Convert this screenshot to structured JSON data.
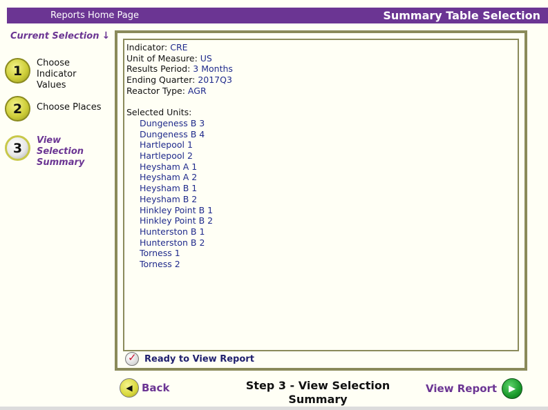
{
  "header": {
    "home_link": "Reports Home Page",
    "title": "Summary Table Selection"
  },
  "sidebar": {
    "current_selection": "Current Selection",
    "steps": [
      {
        "num": "1",
        "label_lines": [
          "Choose",
          "Indicator",
          "Values"
        ]
      },
      {
        "num": "2",
        "label_lines": [
          "Choose Places"
        ]
      },
      {
        "num": "3",
        "label_lines": [
          "View",
          "Selection",
          "Summary"
        ]
      }
    ]
  },
  "summary": {
    "indicator_label": "Indicator:",
    "indicator_value": "CRE",
    "unit_label": "Unit of Measure:",
    "unit_value": "US",
    "period_label": "Results Period:",
    "period_value": "3 Months",
    "quarter_label": "Ending Quarter:",
    "quarter_value": "2017Q3",
    "reactor_label": "Reactor Type:",
    "reactor_value": "AGR",
    "units_label": "Selected Units:",
    "units": [
      "Dungeness B 3",
      "Dungeness B 4",
      "Hartlepool 1",
      "Hartlepool 2",
      "Heysham A 1",
      "Heysham A 2",
      "Heysham B 1",
      "Heysham B 2",
      "Hinkley Point B 1",
      "Hinkley Point B 2",
      "Hunterston B 1",
      "Hunterston B 2",
      "Torness 1",
      "Torness 2"
    ]
  },
  "status": {
    "ready_text": "Ready to View Report",
    "icon": "check-icon"
  },
  "footer": {
    "back_label": "Back",
    "step_caption_line1": "Step 3 - View Selection",
    "step_caption_line2": "Summary",
    "view_report_label": "View Report"
  },
  "colors": {
    "brand_purple": "#6b3593",
    "value_blue": "#1f2a8c",
    "border_olive": "#8a8a5a",
    "next_green": "#1a9a2b"
  }
}
